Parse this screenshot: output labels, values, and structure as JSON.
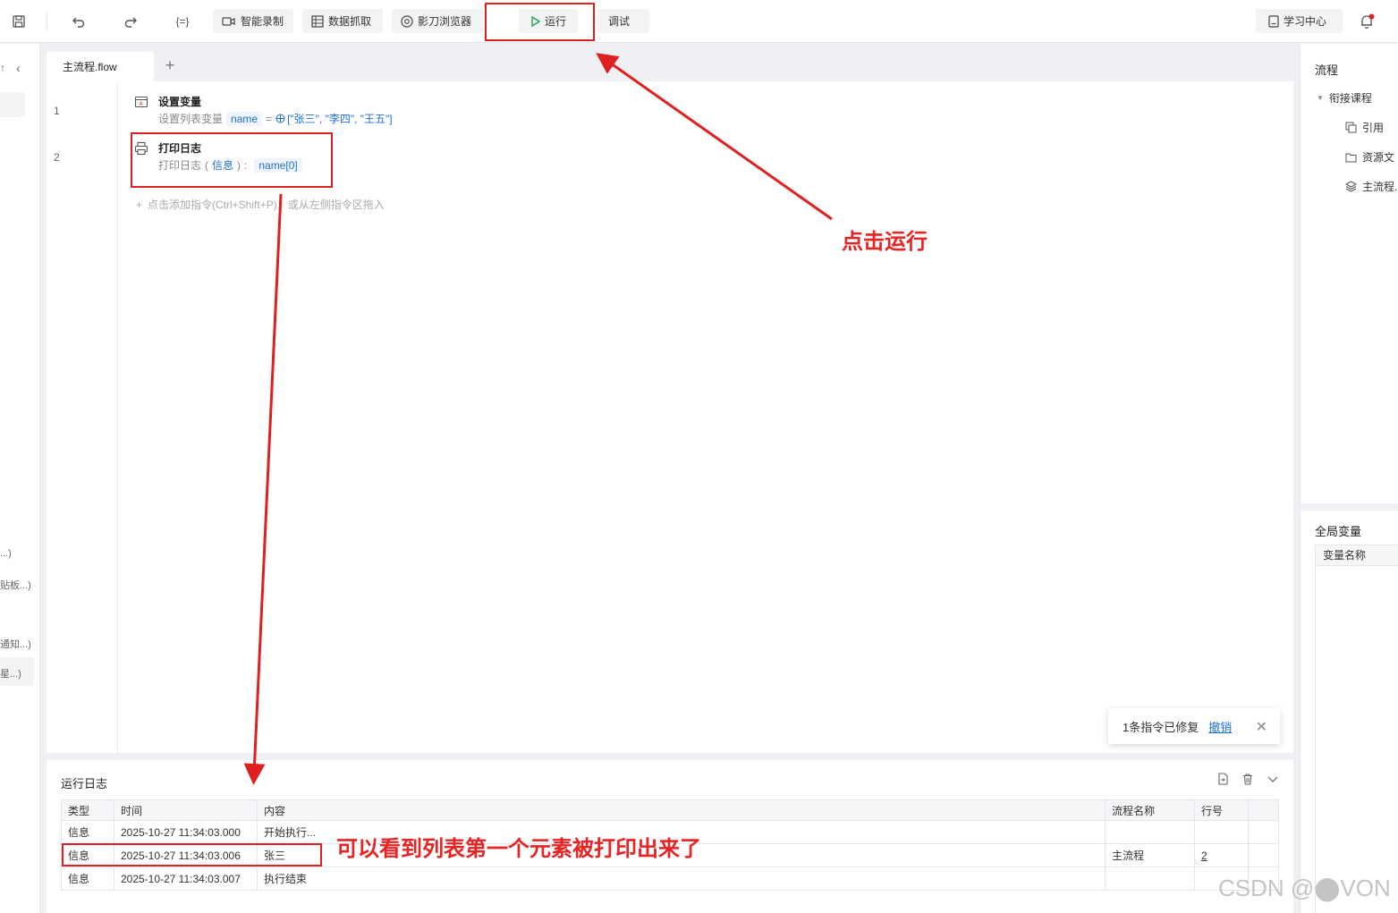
{
  "toolbar": {
    "smart_record": "智能录制",
    "data_capture": "数据抓取",
    "browser": "影刀浏览器",
    "run": "运行",
    "debug": "调试",
    "learn_center": "学习中心"
  },
  "left_strip": {
    "items": [
      "...)",
      "贴板...)",
      "通知...)",
      "星...)"
    ]
  },
  "editor": {
    "tab_name": "主流程.flow",
    "lines": [
      {
        "no": "1",
        "title": "设置变量",
        "desc_prefix": "设置列表变量",
        "var_name": "name",
        "equals": "=",
        "value": "[\"张三\", \"李四\", \"王五\"]"
      },
      {
        "no": "2",
        "title": "打印日志",
        "desc_prefix": "打印日志",
        "paren_open": "(",
        "level": "信息",
        "paren_close": ")",
        "colon": ":",
        "expr": "name[0]"
      }
    ],
    "add_hint": "点击添加指令(Ctrl+Shift+P)，或从左侧指令区拖入"
  },
  "toast": {
    "message": "1条指令已修复",
    "undo": "撤销"
  },
  "log": {
    "title": "运行日志",
    "columns": [
      "类型",
      "时间",
      "内容",
      "流程名称",
      "行号"
    ],
    "rows": [
      {
        "type": "信息",
        "time": "2025-10-27 11:34:03.000",
        "content": "开始执行...",
        "flow": "",
        "line": ""
      },
      {
        "type": "信息",
        "time": "2025-10-27 11:34:03.006",
        "content": "张三",
        "flow": "主流程",
        "line": "2"
      },
      {
        "type": "信息",
        "time": "2025-10-27 11:34:03.007",
        "content": "执行结束",
        "flow": "",
        "line": ""
      }
    ]
  },
  "right_panel": {
    "flow_title": "流程",
    "tree_root": "衔接课程",
    "tree_items": [
      "引用",
      "资源文",
      "主流程."
    ],
    "global_vars_title": "全局变量",
    "var_name_col": "变量名称"
  },
  "annotations": {
    "click_run": "点击运行",
    "note": "可以看到列表第一个元素被打印出来了",
    "color": "#e02020"
  },
  "watermark": "CSDN @⬤VON"
}
